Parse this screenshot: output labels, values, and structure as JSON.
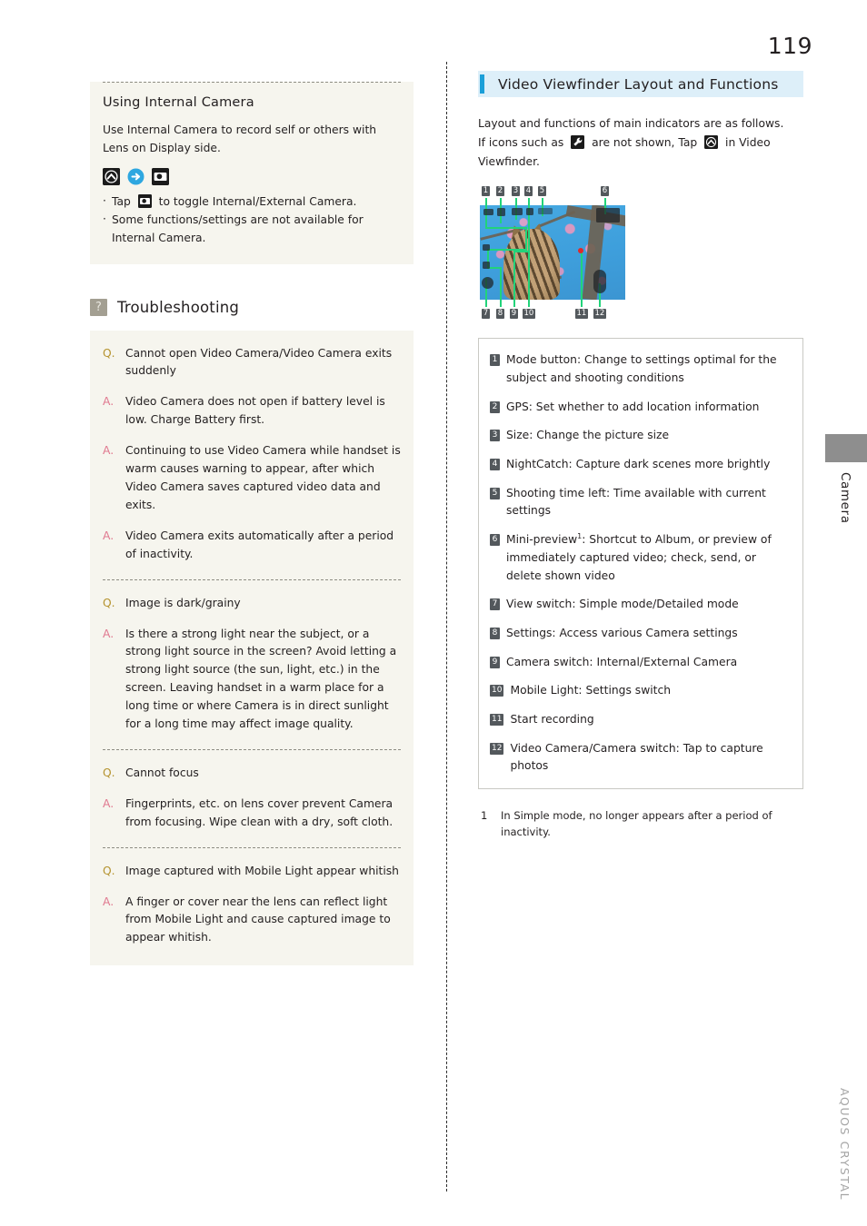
{
  "page": {
    "number": "119",
    "side_tab_label": "Camera",
    "brand_label": "AQUOS CRYSTAL"
  },
  "left_column": {
    "internal_camera": {
      "title": "Using Internal Camera",
      "body": "Use Internal Camera to record self or others with Lens on Display side.",
      "icon_sequence": [
        {
          "name": "viewfinder-expand-icon",
          "glyph": "chevron-up-circle"
        },
        {
          "name": "arrow-right-icon",
          "glyph": "arrow-right"
        },
        {
          "name": "camera-switch-icon",
          "glyph": "camera-switch"
        }
      ],
      "bullets": [
        "Tap  to toggle Internal/External Camera.",
        "Some functions/settings are not available for Internal Camera."
      ],
      "bullet1_pre": "Tap",
      "bullet1_post": "to toggle Internal/External Camera.",
      "bullet2": "Some functions/settings are not available for Internal Camera."
    },
    "troubleshooting": {
      "badge": "?",
      "title": "Troubleshooting",
      "groups": [
        {
          "items": [
            {
              "label": "Q.",
              "type": "q",
              "text": "Cannot open Video Camera/Video Camera exits suddenly"
            },
            {
              "label": "A.",
              "type": "a",
              "text": "Video Camera does not open if battery level is low. Charge Battery first."
            },
            {
              "label": "A.",
              "type": "a",
              "text": "Continuing to use Video Camera while handset is warm causes warning to appear, after which Video Camera saves captured video data and exits."
            },
            {
              "label": "A.",
              "type": "a",
              "text": "Video Camera exits automatically after a period of inactivity."
            }
          ]
        },
        {
          "items": [
            {
              "label": "Q.",
              "type": "q",
              "text": "Image is dark/grainy"
            },
            {
              "label": "A.",
              "type": "a",
              "text": "Is there a strong light near the subject, or a strong light source in the screen? Avoid letting a strong light source (the sun, light, etc.) in the screen. Leaving handset in a warm place for a long time or where Camera is in direct sunlight for a long time may affect image quality."
            }
          ]
        },
        {
          "items": [
            {
              "label": "Q.",
              "type": "q",
              "text": "Cannot focus"
            },
            {
              "label": "A.",
              "type": "a",
              "text": "Fingerprints, etc. on lens cover prevent Camera from focusing. Wipe clean with a dry, soft cloth."
            }
          ]
        },
        {
          "items": [
            {
              "label": "Q.",
              "type": "q",
              "text": "Image captured with Mobile Light appear whitish"
            },
            {
              "label": "A.",
              "type": "a",
              "text": "A finger or cover near the lens can reflect light from Mobile Light and cause captured image to appear whitish."
            }
          ]
        }
      ]
    }
  },
  "right_column": {
    "section_title": "Video Viewfinder Layout and Functions",
    "intro_line1": "Layout and functions of main indicators are as follows.",
    "intro_line2_pre": "If icons such as",
    "intro_line2_mid": "are not shown, Tap",
    "intro_line2_post": "in Video Viewfinder.",
    "figure": {
      "top_callouts": [
        "1",
        "2",
        "3",
        "4",
        "5",
        "6"
      ],
      "bottom_callouts": [
        "7",
        "8",
        "9",
        "10",
        "11",
        "12"
      ],
      "alt": "Video viewfinder preview showing a tabby cat among pink cherry blossoms against blue sky"
    },
    "legend": [
      {
        "num": "1",
        "text": "Mode button: Change to settings optimal for the subject and shooting conditions"
      },
      {
        "num": "2",
        "text": "GPS: Set whether to add location information"
      },
      {
        "num": "3",
        "text": "Size: Change the picture size"
      },
      {
        "num": "4",
        "text": "NightCatch: Capture dark scenes more brightly"
      },
      {
        "num": "5",
        "text": "Shooting time left: Time available with current settings"
      },
      {
        "num": "6",
        "text": "Mini-preview",
        "sup": "1",
        "text_after": ": Shortcut to Album, or preview of immediately captured video; check, send, or delete shown video"
      },
      {
        "num": "7",
        "text": "View switch: Simple mode/Detailed mode"
      },
      {
        "num": "8",
        "text": "Settings: Access various Camera settings"
      },
      {
        "num": "9",
        "text": "Camera switch: Internal/External Camera"
      },
      {
        "num": "10",
        "text": "Mobile Light: Settings switch"
      },
      {
        "num": "11",
        "text": "Start recording"
      },
      {
        "num": "12",
        "text": "Video Camera/Camera switch: Tap to capture photos"
      }
    ],
    "footnote": {
      "num": "1",
      "text": "In Simple mode, no longer appears after a period of inactivity."
    }
  },
  "colors": {
    "band_bg": "#ddeff9",
    "band_bar": "#1b9fd8",
    "tint_bg": "#f6f5ee",
    "q_color": "#b5932f",
    "a_color": "#e0788f",
    "callout_bg": "#53585c",
    "tick_green": "#22d37a"
  }
}
